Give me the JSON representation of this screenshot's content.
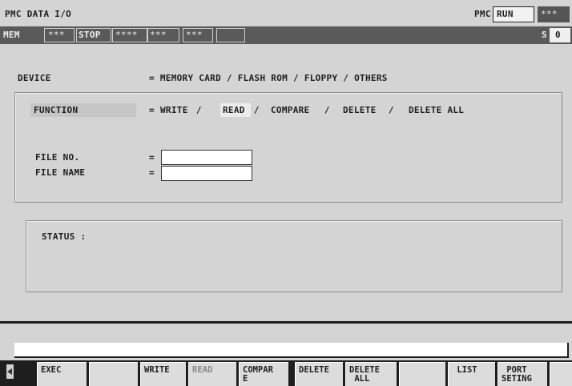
{
  "header": {
    "title": "PMC DATA I/O",
    "pmc_label": "PMC",
    "run_status": "RUN",
    "run_extra": "***"
  },
  "status_bar": {
    "cells": [
      "MEM",
      "***",
      "STOP",
      "****",
      "***",
      "***",
      ""
    ],
    "s_label": "S",
    "s_value": "0"
  },
  "form": {
    "device_label": "DEVICE",
    "device_options": "= MEMORY CARD / FLASH ROM / FLOPPY / OTHERS",
    "function_label": "FUNCTION",
    "function_eq": "=",
    "function_options": [
      {
        "label": "WRITE",
        "sep": " / "
      },
      {
        "label": "READ",
        "sep": " / ",
        "selected": true
      },
      {
        "label": "COMPARE",
        "sep": " / "
      },
      {
        "label": "DELETE",
        "sep": " / "
      },
      {
        "label": "DELETE ALL",
        "sep": ""
      }
    ],
    "file_no_label": "FILE NO.",
    "file_no_eq": "=",
    "file_no_value": "",
    "file_name_label": "FILE NAME",
    "file_name_eq": "=",
    "file_name_value": "",
    "status_label": "STATUS :"
  },
  "input_line": {
    "value": ""
  },
  "softkeys": [
    {
      "l1": "EXEC",
      "l2": ""
    },
    {
      "l1": "",
      "l2": ""
    },
    {
      "l1": "WRITE",
      "l2": ""
    },
    {
      "l1": "READ",
      "l2": "",
      "dim": true
    },
    {
      "l1": "COMPAR",
      "l2": "E"
    },
    {
      "l1": "DELETE",
      "l2": ""
    },
    {
      "l1": "DELETE",
      "l2": " ALL"
    },
    {
      "l1": "",
      "l2": ""
    },
    {
      "l1": " LIST",
      "l2": ""
    },
    {
      "l1": " PORT",
      "l2": "SETING"
    }
  ]
}
